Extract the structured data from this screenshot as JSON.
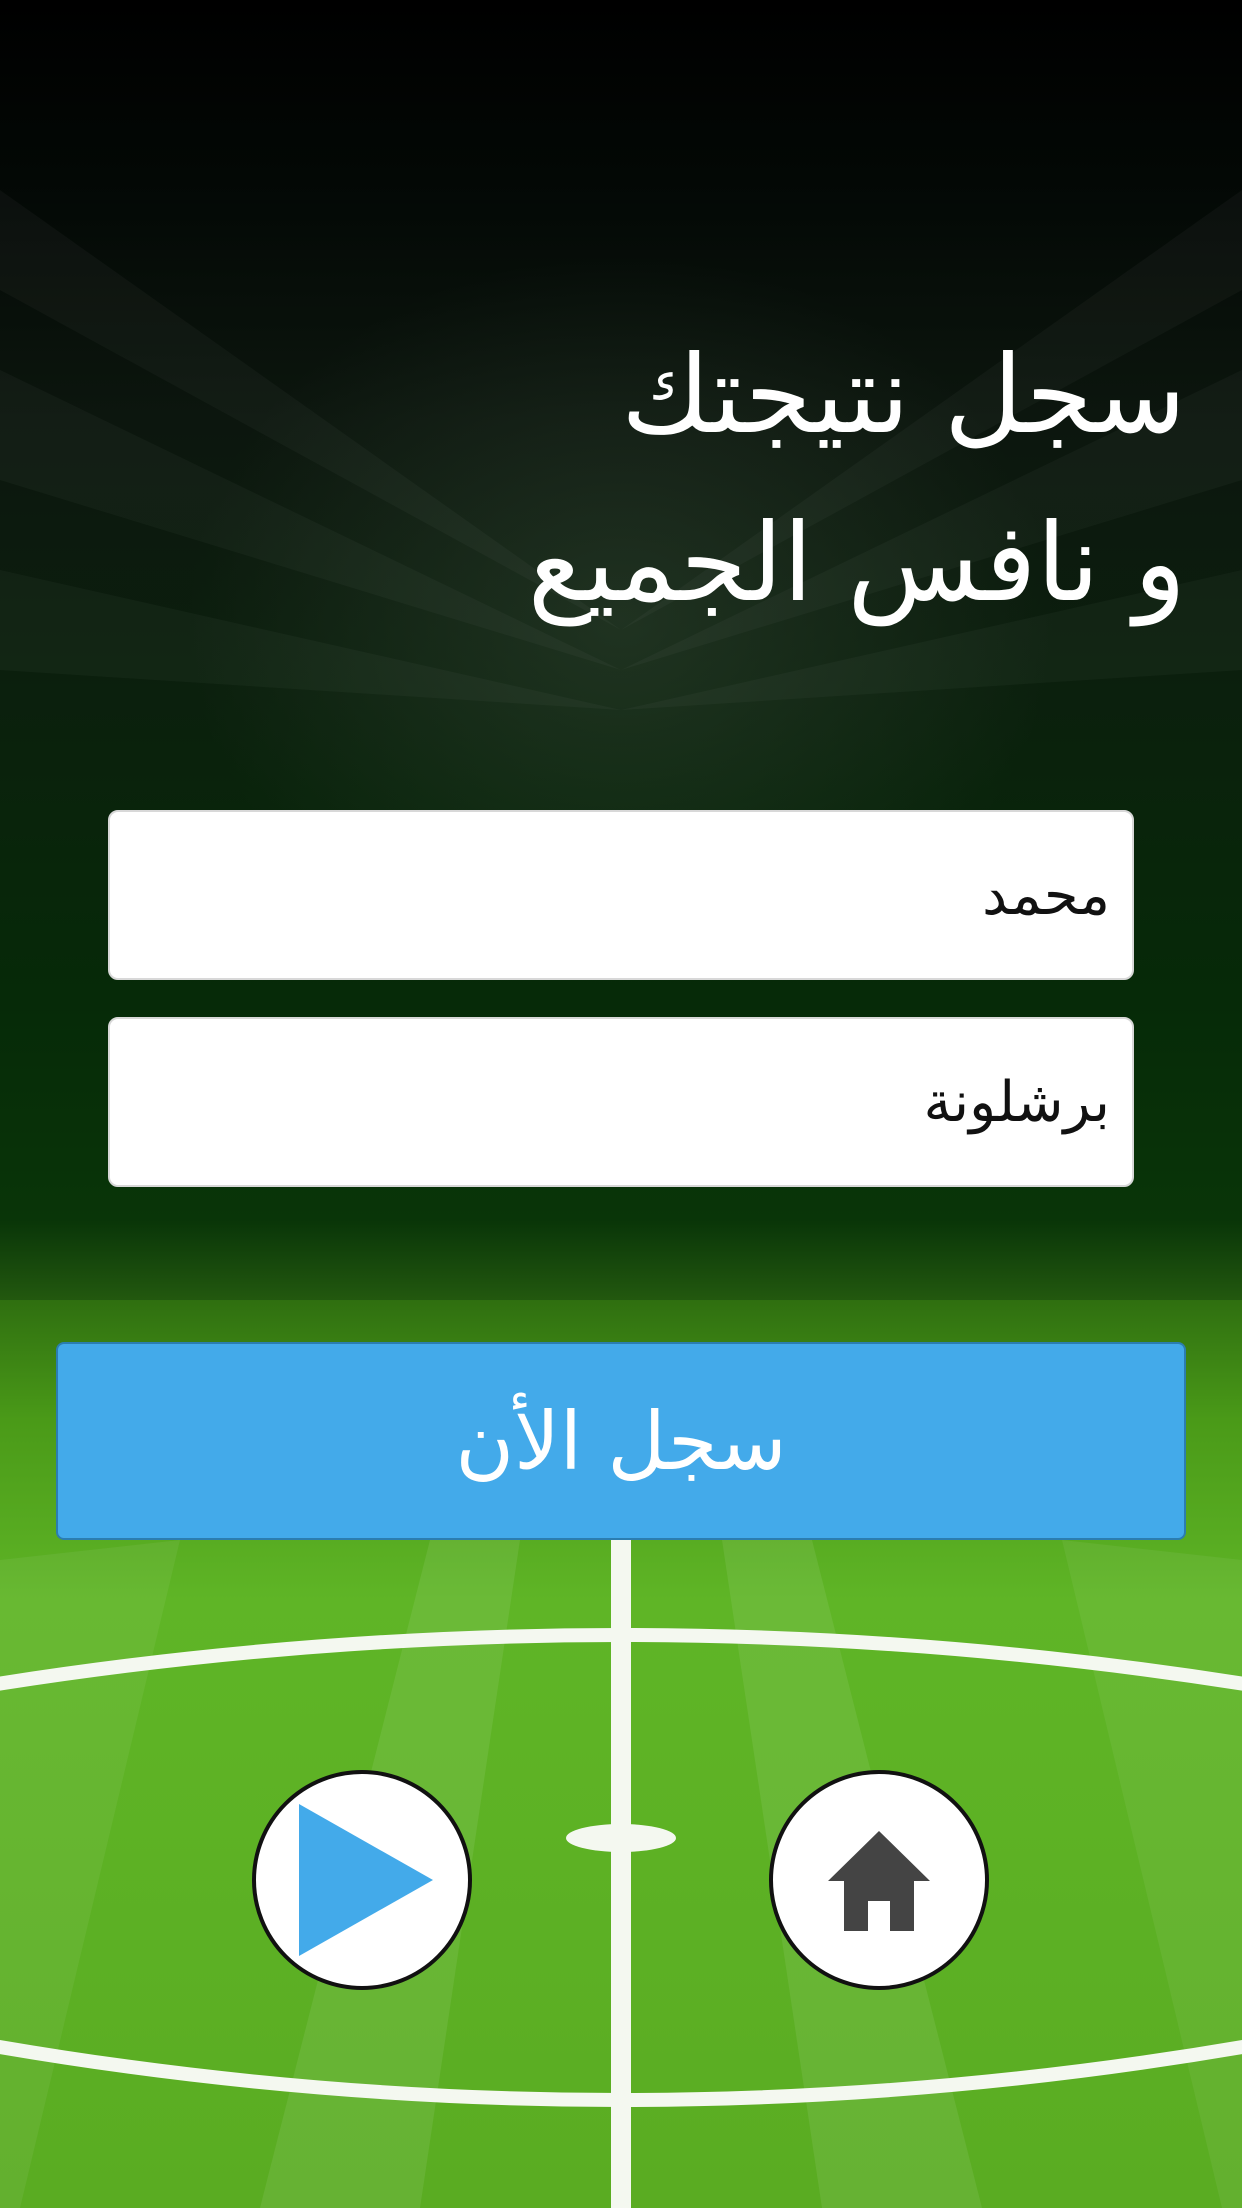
{
  "headline": {
    "line1": "سجل نتيجتك",
    "line2": "و نافس الجميع"
  },
  "form": {
    "name_value": "محمد",
    "team_value": "برشلونة"
  },
  "register_button": {
    "label": "سجل الأن",
    "color": "#43aaea"
  },
  "nav": {
    "play_icon": "play-icon",
    "home_icon": "home-icon"
  },
  "colors": {
    "field_green": "#5fb526",
    "accent_blue": "#43aaea"
  }
}
